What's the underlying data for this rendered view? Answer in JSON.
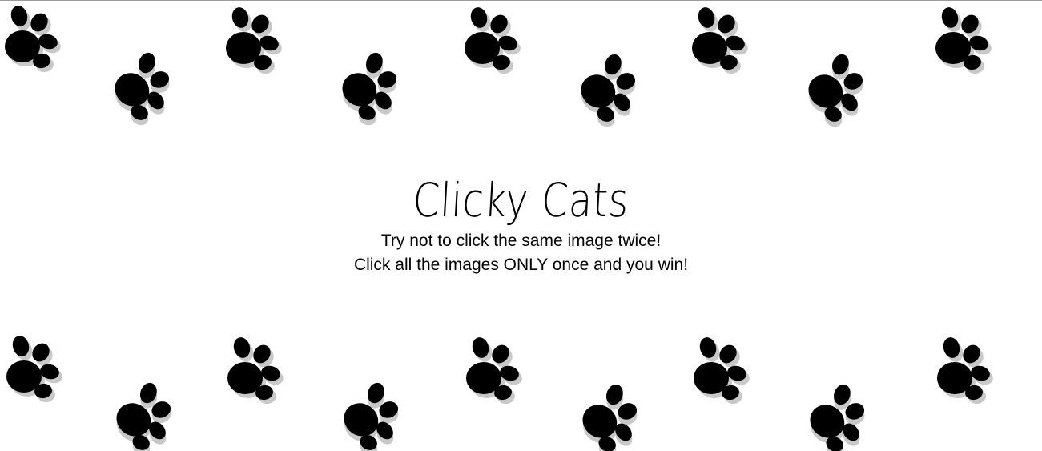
{
  "header": {
    "title": "Clicky Cats",
    "line1": "Try not to click the same image twice!",
    "line2": "Click all the images ONLY once and you win!"
  },
  "background": {
    "pattern_icon": "paw-print-icon",
    "paw_color": "#000000",
    "shadow_color": "#c8c8c8",
    "page_color": "#ffffff"
  }
}
